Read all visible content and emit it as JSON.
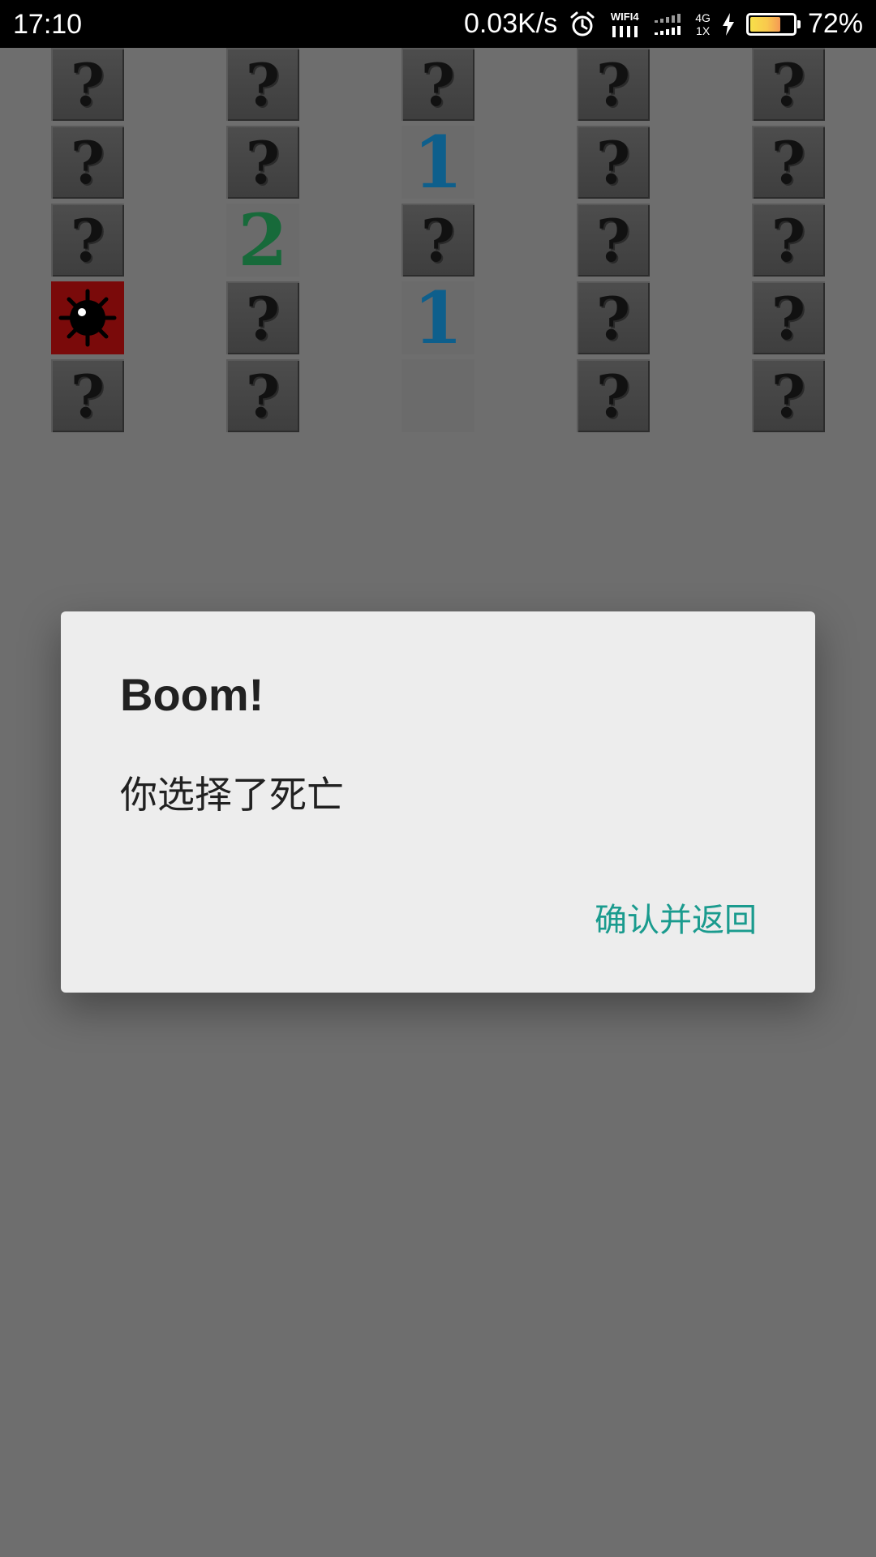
{
  "status_bar": {
    "time": "17:10",
    "net_speed": "0.03K/s",
    "wifi_label": "WIFI4",
    "net_type_top": "4G",
    "net_type_bottom": "1X",
    "battery_percent_text": "72%",
    "battery_level": 0.72
  },
  "board": {
    "rows": [
      [
        "?",
        "?",
        "?",
        "?",
        "?"
      ],
      [
        "?",
        "?",
        "1",
        "?",
        "?"
      ],
      [
        "?",
        "2",
        "?",
        "?",
        "?"
      ],
      [
        "mine",
        "?",
        "1",
        "?",
        "?"
      ],
      [
        "?",
        "?",
        "",
        "?",
        "?"
      ]
    ],
    "colors": {
      "one": "#0e5f8c",
      "two": "#176a3a",
      "mine_bg": "#7a0a0a"
    }
  },
  "dialog": {
    "title": "Boom!",
    "message": "你选择了死亡",
    "confirm_label": "确认并返回"
  },
  "colors": {
    "accent": "#1a9b8e",
    "scrim_bg": "#6e6e6e"
  }
}
